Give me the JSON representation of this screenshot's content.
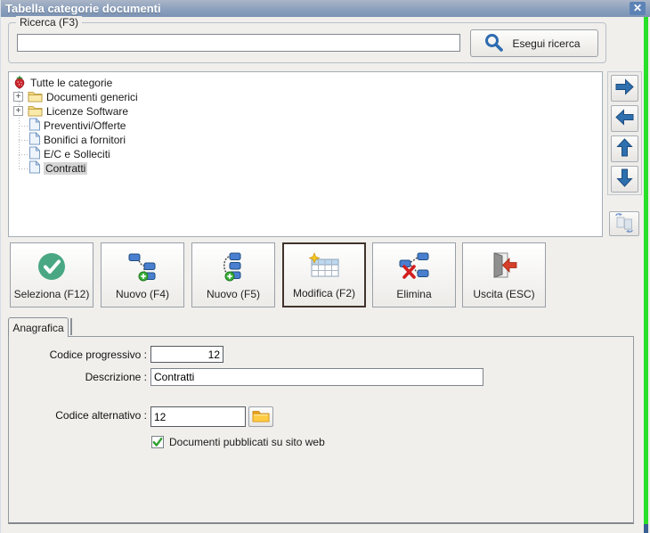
{
  "window": {
    "title": "Tabella categorie documenti",
    "close_glyph": "✕"
  },
  "search": {
    "group_label": "Ricerca (F3)",
    "input_value": "",
    "button_label": "Esegui ricerca",
    "button_icon": "magnifier-icon"
  },
  "tree": {
    "items": [
      {
        "label": "Tutte le categorie",
        "icon": "strawberry-icon",
        "selected": false
      },
      {
        "label": "Documenti generici",
        "icon": "folder-icon",
        "expandable": true,
        "expand_glyph": "+",
        "selected": false
      },
      {
        "label": "Licenze Software",
        "icon": "folder-icon",
        "expandable": true,
        "expand_glyph": "+",
        "selected": false
      },
      {
        "label": "Preventivi/Offerte",
        "icon": "document-icon",
        "selected": false
      },
      {
        "label": "Bonifici a fornitori",
        "icon": "document-icon",
        "selected": false
      },
      {
        "label": "E/C e Solleciti",
        "icon": "document-icon",
        "selected": false
      },
      {
        "label": "Contratti",
        "icon": "document-icon",
        "selected": true
      }
    ]
  },
  "side_buttons": {
    "icons": [
      "arrow-right-icon",
      "arrow-left-icon",
      "arrow-up-icon",
      "arrow-down-icon",
      "swap-documents-icon"
    ]
  },
  "toolbar": {
    "buttons": [
      {
        "label": "Seleziona (F12)",
        "icon": "check-circle-icon",
        "focused": false
      },
      {
        "label": "Nuovo (F4)",
        "icon": "new-child-node-icon",
        "focused": false
      },
      {
        "label": "Nuovo (F5)",
        "icon": "new-sibling-node-icon",
        "focused": false
      },
      {
        "label": "Modifica (F2)",
        "icon": "edit-table-icon",
        "focused": true
      },
      {
        "label": "Elimina",
        "icon": "delete-node-icon",
        "focused": false
      },
      {
        "label": "Uscita (ESC)",
        "icon": "exit-door-icon",
        "focused": false
      }
    ]
  },
  "tabs": [
    {
      "label": "Anagrafica",
      "selected": true
    }
  ],
  "form": {
    "codice_progressivo": {
      "label": "Codice progressivo :",
      "value": "12"
    },
    "descrizione": {
      "label": "Descrizione :",
      "value": "Contratti"
    },
    "codice_alternativo": {
      "label": "Codice alternativo :",
      "value": "12",
      "browse_icon": "folder-open-icon"
    },
    "published": {
      "label": "Documenti pubblicati su sito web",
      "checked": true
    }
  },
  "colors": {
    "titlebar_top": "#aab5c7",
    "titlebar_bottom": "#7b93b4",
    "accent_blue": "#2e6fae",
    "success_green": "#49a883",
    "danger_red": "#d21f1f",
    "folder_amber": "#ffcc44",
    "selection_gray": "#d6d6d6",
    "edge_green": "#29e029",
    "dialog_bg": "#f0efec"
  }
}
